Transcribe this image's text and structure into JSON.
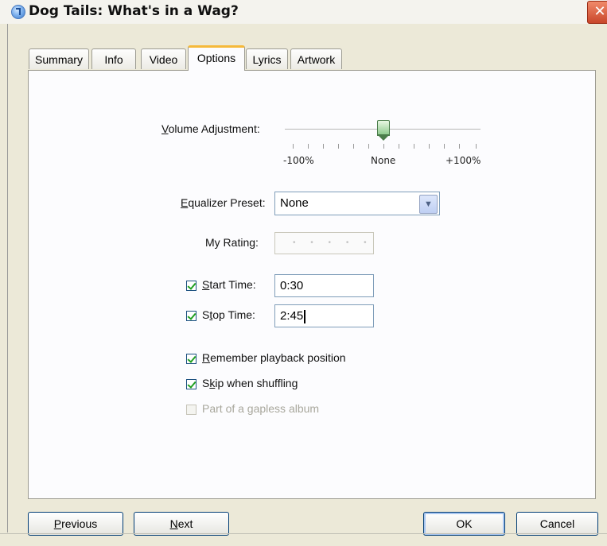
{
  "window": {
    "title": "Dog Tails: What's in a Wag?",
    "close_glyph": "✕"
  },
  "tabs": [
    {
      "label": "Summary"
    },
    {
      "label": "Info"
    },
    {
      "label": "Video"
    },
    {
      "label": "Options",
      "active": true
    },
    {
      "label": "Lyrics"
    },
    {
      "label": "Artwork"
    }
  ],
  "options": {
    "volume": {
      "label_mnemonic": "V",
      "label_rest": "olume Adjustment:",
      "min_label": "-100%",
      "mid_label": "None",
      "max_label": "+100%",
      "value_percent": 0
    },
    "equalizer": {
      "label_mnemonic": "E",
      "label_rest": "qualizer Preset:",
      "value": "None"
    },
    "rating": {
      "label": "My Rating:",
      "dots": "• • • • •",
      "value": 0
    },
    "start_time": {
      "label_mnemonic": "S",
      "label_rest": "tart Time:",
      "value": "0:30",
      "checked": true
    },
    "stop_time": {
      "label_pre": "S",
      "label_mnemonic": "t",
      "label_rest": "op Time:",
      "value": "2:45",
      "checked": true
    },
    "remember_playback": {
      "label_mnemonic": "R",
      "label_rest": "emember playback position",
      "checked": true
    },
    "skip_shuffle": {
      "label_pre": "S",
      "label_mnemonic": "k",
      "label_rest": "ip when shuffling",
      "checked": true
    },
    "gapless": {
      "label": "Part of a gapless album",
      "checked": false,
      "enabled": false
    }
  },
  "buttons": {
    "previous": {
      "mnemonic": "P",
      "rest": "revious"
    },
    "next": {
      "mnemonic": "N",
      "rest": "ext"
    },
    "ok": "OK",
    "cancel": "Cancel"
  },
  "colors": {
    "accent_tab": "#f5b93a",
    "check": "#21a121",
    "close": "#c9462a"
  }
}
